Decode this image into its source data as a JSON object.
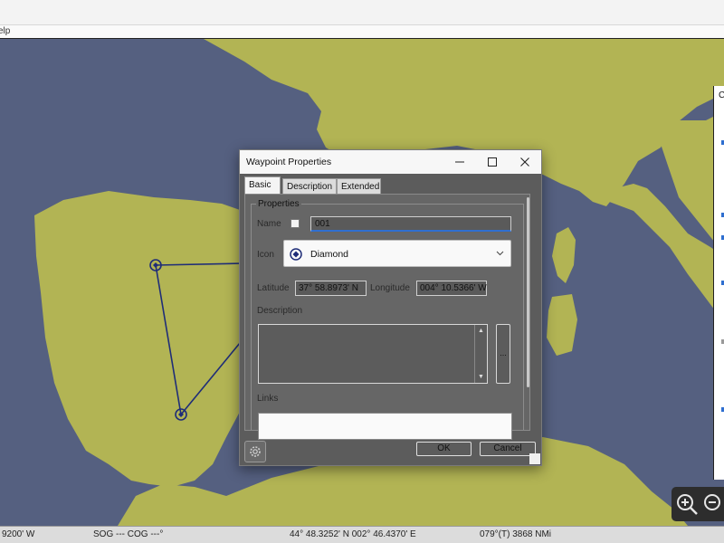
{
  "menubar": {
    "help_label": "elp"
  },
  "dialog": {
    "title": "Waypoint Properties",
    "tabs": [
      "Basic",
      "Description",
      "Extended"
    ],
    "properties_group": "Properties",
    "name_label": "Name",
    "name_value": "001",
    "name_checkbox_checked": false,
    "icon_label": "Icon",
    "icon_value": "Diamond",
    "icon_symbol": "diamond-icon",
    "latitude_label": "Latitude",
    "latitude_value": "37° 58.8973' N",
    "longitude_label": "Longitude",
    "longitude_value": "004° 10.5366' W",
    "description_label": "Description",
    "description_value": "",
    "more_button": "...",
    "links_label": "Links",
    "ok_label": "OK",
    "cancel_label": "Cancel"
  },
  "statusbar": {
    "cursor_lon": "9200' W",
    "sog_cog": "SOG --- COG ---°",
    "position": "44° 48.3252' N   002° 46.4370' E",
    "bearing_distance": "079°(T)  3868 NMi"
  },
  "right_panel": {
    "letter": "C"
  },
  "colors": {
    "sea": "#556080",
    "land": "#b2b454",
    "route": "#1f2d78",
    "dialog_bg": "#5c5c5c",
    "accent": "#2f6fd0"
  }
}
